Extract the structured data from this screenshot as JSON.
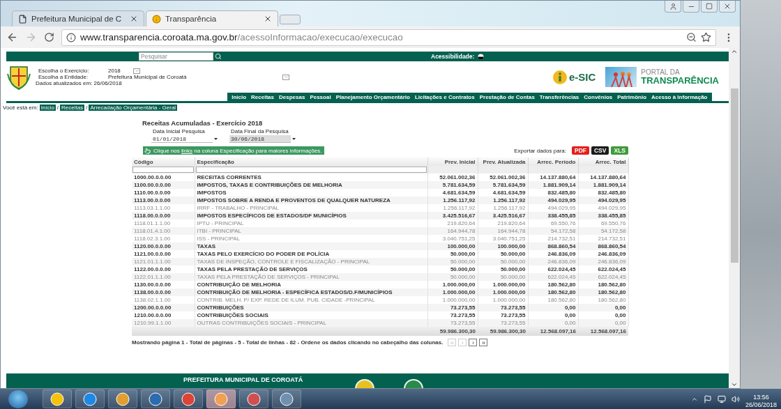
{
  "browser": {
    "tabs": [
      {
        "title": "Prefeitura Municipal de C",
        "selected": false
      },
      {
        "title": "Transparência",
        "selected": true
      }
    ],
    "url": {
      "domain": "www.transparencia.coroata.ma.gov.br",
      "path": "/acessoInformacao/execucao/execucao"
    }
  },
  "page": {
    "search": {
      "placeholder": "Pesquisar"
    },
    "accessibility": "Acessibilidade:",
    "filters": [
      {
        "label": "Escolha o Exercício:",
        "value": "2018"
      },
      {
        "label": "Escolha a Entidade:",
        "value": "Prefeitura Municipal de Coroatá"
      }
    ],
    "updated": "Dados atualizados em: 26/06/2018",
    "esic": "e-SIC",
    "portal": {
      "line1": "PORTAL DA",
      "line2": "TRANSPARÊNCIA"
    },
    "nav": [
      "Início",
      "Receitas",
      "Despesas",
      "Pessoal",
      "Planejamento Orçamentário",
      "Licitações e Contratos",
      "Prestação de Contas",
      "Transferências",
      "Convênios",
      "Patrimônio",
      "Acesso à Informação"
    ],
    "breadcrumb": {
      "label": "Você está em:",
      "parts": [
        {
          "kind": "link",
          "text": "Início"
        },
        {
          "kind": "sep",
          "text": "/"
        },
        {
          "kind": "link",
          "text": "Receitas"
        },
        {
          "kind": "sep",
          "text": "/"
        },
        {
          "kind": "link",
          "text": "Arrecadação Orçamentária - Geral"
        }
      ]
    },
    "report": {
      "title": "Receitas Acumuladas - Exercício 2018",
      "dates": [
        {
          "label": "Data Inicial Pesquisa",
          "value": "01/01/2018",
          "disabled": false
        },
        {
          "label": "Data Final da Pesquisa",
          "value": "30/06/2018",
          "disabled": true
        }
      ],
      "hint": {
        "before": "Clique nos ",
        "link": "links",
        "after": " na coluna Especificação para maiores informações."
      },
      "export": {
        "label": "Exportar dados para:",
        "formats": [
          {
            "label": "PDF",
            "color": "#e3201c"
          },
          {
            "label": "CSV",
            "color": "#1c1c1c"
          },
          {
            "label": "XLS",
            "color": "#3f9a3a"
          }
        ]
      },
      "table": {
        "columns": [
          "Código",
          "Especificação",
          "Prev. Inicial",
          "Prev. Atualizada",
          "Arrec. Período",
          "Arrec. Total"
        ],
        "rows": [
          {
            "kind": "group",
            "cells": [
              "1000.00.0.0.00",
              "RECEITAS CORRENTES",
              "52.061.002,36",
              "52.061.002,36",
              "14.137.880,64",
              "14.137.880,64"
            ]
          },
          {
            "kind": "group",
            "cells": [
              "1100.00.0.0.00",
              "IMPOSTOS, TAXAS E CONTRIBUIÇÕES DE MELHORIA",
              "5.781.634,59",
              "5.781.634,59",
              "1.881.909,14",
              "1.881.909,14"
            ]
          },
          {
            "kind": "group",
            "cells": [
              "1110.00.0.0.00",
              "IMPOSTOS",
              "4.681.634,59",
              "4.681.634,59",
              "832.485,80",
              "832.485,80"
            ]
          },
          {
            "kind": "group",
            "cells": [
              "1113.00.0.0.00",
              "IMPOSTOS SOBRE A RENDA E PROVENTOS DE QUALQUER NATUREZA",
              "1.256.117,92",
              "1.256.117,92",
              "494.029,95",
              "494.029,95"
            ]
          },
          {
            "kind": "item",
            "cells": [
              "1113.03.1.1.00",
              "IRRF - TRABALHO - PRINCIPAL",
              "1.256.117,92",
              "1.256.117,92",
              "494.029,95",
              "494.029,95"
            ]
          },
          {
            "kind": "group",
            "cells": [
              "1118.00.0.0.00",
              "IMPOSTOS ESPECÍFICOS DE ESTADOS/DF MUNICÍPIOS",
              "3.425.516,67",
              "3.425.516,67",
              "338.455,85",
              "338.455,85"
            ]
          },
          {
            "kind": "item",
            "cells": [
              "1118.01.1.1.00",
              "IPTU - PRINCIPAL",
              "219.820,64",
              "219.820,64",
              "69.550,76",
              "69.550,76"
            ]
          },
          {
            "kind": "item",
            "cells": [
              "1118.01.4.1.00",
              "ITBI - PRINCIPAL",
              "164.944,78",
              "164.944,78",
              "54.172,58",
              "54.172,58"
            ]
          },
          {
            "kind": "item",
            "cells": [
              "1118.02.3.1.00",
              "ISS - PRINCIPAL",
              "3.040.751,25",
              "3.040.751,25",
              "214.732,51",
              "214.732,51"
            ]
          },
          {
            "kind": "group",
            "cells": [
              "1120.00.0.0.00",
              "TAXAS",
              "100.000,00",
              "100.000,00",
              "868.860,54",
              "868.860,54"
            ]
          },
          {
            "kind": "group",
            "cells": [
              "1121.00.0.0.00",
              "TAXAS PELO EXERCÍCIO DO PODER DE POLÍCIA",
              "50.000,00",
              "50.000,00",
              "246.836,09",
              "246.836,09"
            ]
          },
          {
            "kind": "item",
            "cells": [
              "1121.01.1.1.00",
              "TAXAS DE INSPEÇÃO, CONTROLE E FISCALIZAÇÃO - PRINCIPAL",
              "50.000,00",
              "50.000,00",
              "246.836,09",
              "246.836,09"
            ]
          },
          {
            "kind": "group",
            "cells": [
              "1122.00.0.0.00",
              "TAXAS PELA PRESTAÇÃO DE SERVIÇOS",
              "50.000,00",
              "50.000,00",
              "622.024,45",
              "622.024,45"
            ]
          },
          {
            "kind": "item",
            "cells": [
              "1122.01.1.1.00",
              "TAXAS PELA PRESTAÇÃO DE SERVIÇOS - PRINCIPAL",
              "50.000,00",
              "50.000,00",
              "622.024,45",
              "622.024,45"
            ]
          },
          {
            "kind": "group",
            "cells": [
              "1130.00.0.0.00",
              "CONTRIBUIÇÃO DE MELHORIA",
              "1.000.000,00",
              "1.000.000,00",
              "180.562,80",
              "180.562,80"
            ]
          },
          {
            "kind": "group",
            "cells": [
              "1138.00.0.0.00",
              "CONTRIBUIÇÃO DE MELHORIA - ESPECÍFICA ESTADOS/D.F/MUNICÍPIOS",
              "1.000.000,00",
              "1.000.000,00",
              "180.562,80",
              "180.562,80"
            ]
          },
          {
            "kind": "item",
            "cells": [
              "1138.02.1.1.00",
              "CONTRIB. MELH. P/ EXP. REDE DE ILUM. PUB. CIDADE -PRINCIPAL",
              "1.000.000,00",
              "1.000.000,00",
              "180.562,80",
              "180.562,80"
            ]
          },
          {
            "kind": "group",
            "cells": [
              "1200.00.0.0.00",
              "CONTRIBUIÇÕES",
              "73.273,55",
              "73.273,55",
              "0,00",
              "0,00"
            ]
          },
          {
            "kind": "group",
            "cells": [
              "1210.00.0.0.00",
              "CONTRIBUIÇÕES SOCIAIS",
              "73.273,55",
              "73.273,55",
              "0,00",
              "0,00"
            ]
          },
          {
            "kind": "item",
            "cells": [
              "1210.99.1.1.00",
              "OUTRAS CONTRIBUIÇÕES SOCIAIS - PRINCIPAL",
              "73.273,55",
              "73.273,55",
              "0,00",
              "0,00"
            ]
          }
        ],
        "totals": [
          "59.986.300,30",
          "59.986.300,30",
          "12.568.097,16",
          "12.568.097,16"
        ]
      },
      "pager": {
        "text": "Mostrando página 1 - Total de páginas - 5 - Total de linhas - 82 - Ordene os dados clicando no cabeçalho das colunas.",
        "buttons": [
          {
            "label": "«",
            "disabled": true
          },
          {
            "label": "‹",
            "disabled": true
          },
          {
            "label": "›",
            "disabled": false
          },
          {
            "label": "»",
            "disabled": false
          }
        ]
      }
    },
    "footer": {
      "title": "PREFEITURA MUNICIPAL DE COROATÁ"
    }
  },
  "taskbar": {
    "time": "13:56",
    "date": "26/06/2018"
  }
}
